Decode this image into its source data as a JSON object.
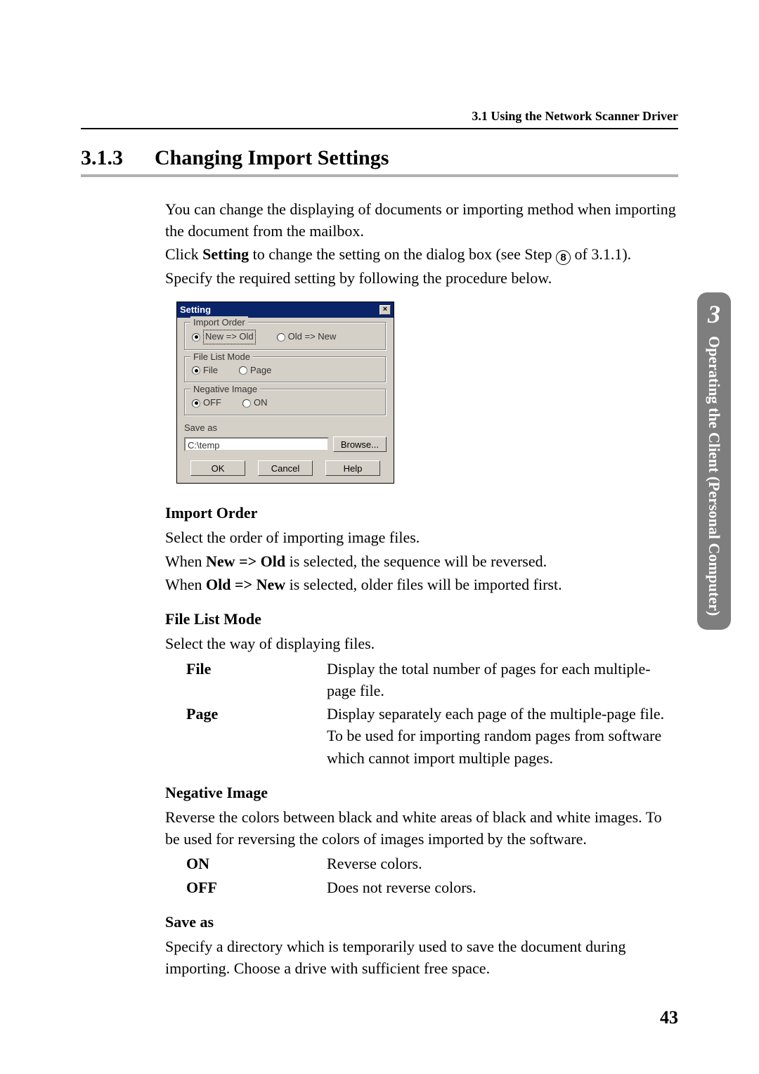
{
  "header": "3.1  Using the Network Scanner Driver",
  "section": {
    "num": "3.1.3",
    "title": "Changing Import Settings"
  },
  "intro": {
    "p1": "You can change the displaying of documents or importing method when importing the document from the mailbox.",
    "p2a": "Click ",
    "p2b": "Setting",
    "p2c": " to change the setting on the dialog box (see Step ",
    "p2step": "8",
    "p2d": " of 3.1.1).",
    "p3": "Specify the required setting by following the procedure below."
  },
  "dialog": {
    "title": "Setting",
    "group_import": "Import Order",
    "opt_new_old": "New => Old",
    "opt_old_new": "Old => New",
    "group_filelist": "File List Mode",
    "opt_file": "File",
    "opt_page": "Page",
    "group_neg": "Negative Image",
    "opt_off": "OFF",
    "opt_on": "ON",
    "save_label": "Save as",
    "save_value": "C:\\temp",
    "browse": "Browse...",
    "ok": "OK",
    "cancel": "Cancel",
    "help": "Help"
  },
  "importOrder": {
    "h": "Import Order",
    "p1": "Select the order of importing image files.",
    "p2a": "When ",
    "p2b": "New => Old",
    "p2c": " is selected, the sequence will be reversed.",
    "p3a": "When ",
    "p3b": "Old => New",
    "p3c": " is selected, older files will be imported first."
  },
  "fileListMode": {
    "h": "File List Mode",
    "p": "Select the way of displaying files.",
    "rows": {
      "file": {
        "t": "File",
        "d": "Display the total number of pages for each multiple-page file."
      },
      "page": {
        "t": "Page",
        "d": "Display separately each page of the multiple-page file. To be used for importing random pages from software which cannot import multiple pages."
      }
    }
  },
  "negImage": {
    "h": "Negative Image",
    "p": "Reverse the colors between black and white areas of black and white images. To be used for reversing the colors of images imported by the software.",
    "rows": {
      "on": {
        "t": "ON",
        "d": "Reverse colors."
      },
      "off": {
        "t": "OFF",
        "d": "Does not reverse colors."
      }
    }
  },
  "saveAs": {
    "h": "Save as",
    "p": "Specify a directory which is temporarily used to save the document during importing. Choose a drive with sufficient free space."
  },
  "sideTab": {
    "num": "3",
    "label": "Operating the Client (Personal Computer)"
  },
  "pageNum": "43"
}
